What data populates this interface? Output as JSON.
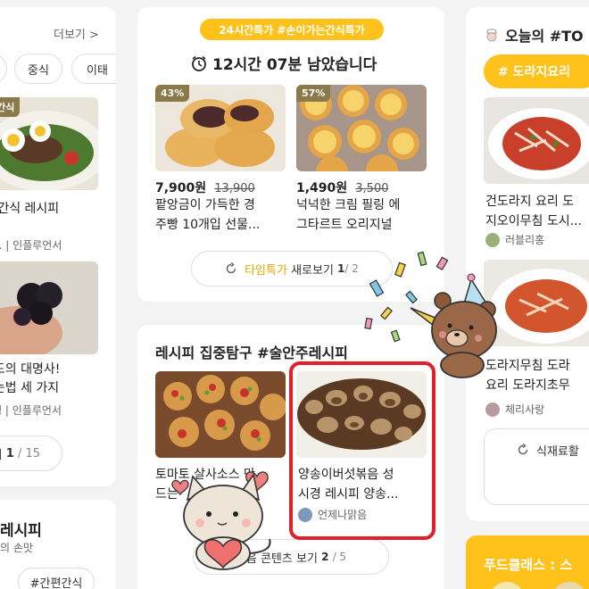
{
  "left_col": {
    "more_link": "더보기 >",
    "chips": [
      "",
      "중식",
      "이태"
    ],
    "post1": {
      "badge": "주간식",
      "title": "된 간식 레시피",
      "meta": "타...  |  인플루언서"
    },
    "post2": {
      "title": "푸드의 대명사!",
      "title2": "먹는법 세 가지",
      "meta": "는댕  |  인플루언서"
    },
    "pager": {
      "label": "기",
      "current": "1",
      "total": "/ 15"
    },
    "card2_title": "레시피",
    "card2_sub": "의 손맛",
    "card2_chip": "#간편간식"
  },
  "deal": {
    "tag": "24시간특가 #손이가는간식특가",
    "countdown": "12시간 07분 남았습니다",
    "items": [
      {
        "discount": "43%",
        "price": "7,900원",
        "old_price": "13,900",
        "name1": "팥앙금이 가득한 경",
        "name2": "주빵 10개입 선물..."
      },
      {
        "discount": "57%",
        "price": "1,490원",
        "old_price": "3,500",
        "name1": "넉넉한 크림 필링 에",
        "name2": "그타르트 오리지널"
      }
    ],
    "more": {
      "accent": "타임특가",
      "label": "새로보기",
      "current": "1",
      "total": "/ 2"
    }
  },
  "recipe": {
    "title": "레시피 집중탐구 #술안주레시피",
    "items": [
      {
        "title1": "토마토 살사소스 만",
        "title2": "드는"
      },
      {
        "title1": "양송이버섯볶음 성",
        "title2": "시경 레시피 양송...",
        "author": "언제나맑음"
      }
    ],
    "more": {
      "label": "다음 콘텐츠 보기",
      "current": "2",
      "total": "/ 5"
    }
  },
  "right_col": {
    "title": "오늘의 #TO",
    "chip": "# 도라지요리",
    "post1": {
      "title1": "건도라지 요리 도",
      "title2": "지오이무침 도시...",
      "author": "러블리홍"
    },
    "post2": {
      "title1": "도라지무침 도라",
      "title2": "요리 도라지초무",
      "author": "체리사랑"
    },
    "button": "식재료활",
    "banner": "푸드클래스 : 스"
  },
  "colors": {
    "accent_yellow": "#ffc21a",
    "highlight_red": "#e0202a",
    "deal_tag_text": "#fff"
  }
}
